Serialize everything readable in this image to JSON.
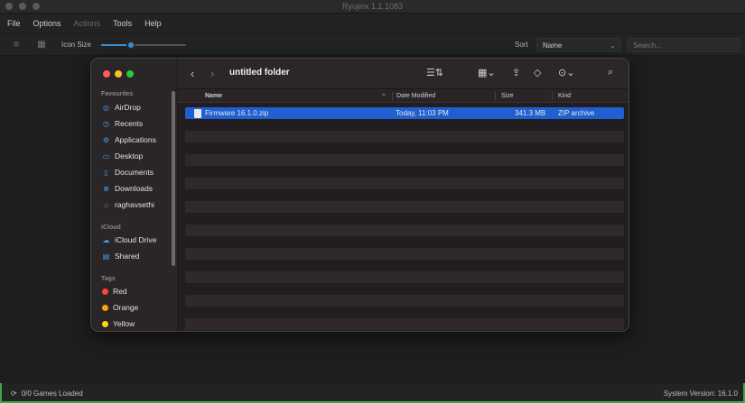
{
  "window": {
    "title": "Ryujinx 1.1.1083"
  },
  "menu": {
    "items": [
      "File",
      "Options",
      "Actions",
      "Tools",
      "Help"
    ]
  },
  "toolbar": {
    "icon_size_label": "Icon Size",
    "icon_size_level": 0.35,
    "sort_label": "Sort",
    "sort_value": "Name",
    "search_placeholder": "Search..."
  },
  "status": {
    "games_loaded": "0/0 Games Loaded",
    "system_version": "System Version: 16.1.0"
  },
  "finder": {
    "folder_title": "untitled folder",
    "sidebar": {
      "favourites_label": "Favourites",
      "favourites": [
        "AirDrop",
        "Recents",
        "Applications",
        "Desktop",
        "Documents",
        "Downloads",
        "raghavsethi"
      ],
      "icloud_label": "iCloud",
      "icloud": [
        "iCloud Drive",
        "Shared"
      ],
      "tags_label": "Tags",
      "tags": [
        {
          "label": "Red",
          "color": "#ff453a"
        },
        {
          "label": "Orange",
          "color": "#ff9f0a"
        },
        {
          "label": "Yellow",
          "color": "#ffd60a"
        }
      ]
    },
    "columns": {
      "name": "Name",
      "date": "Date Modified",
      "size": "Size",
      "kind": "Kind"
    },
    "files": [
      {
        "name": "Firmware 16.1.0.zip",
        "date": "Today, 11:03 PM",
        "size": "341.3 MB",
        "kind": "ZIP archive",
        "selected": true
      }
    ],
    "accent": "#1f5fd0"
  }
}
